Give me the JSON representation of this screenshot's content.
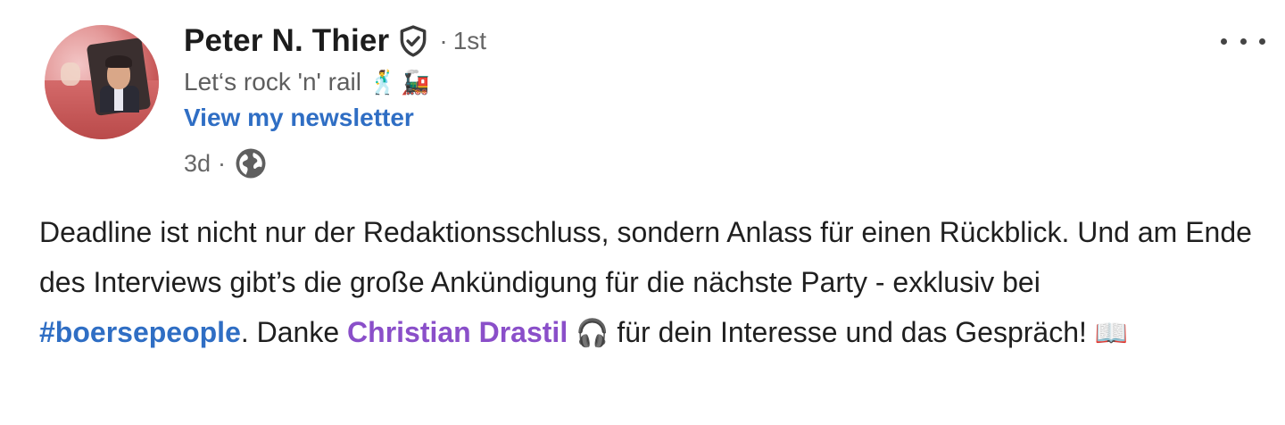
{
  "post": {
    "author": {
      "name": "Peter N. Thier",
      "degree_sep": "·",
      "degree": "1st",
      "tagline": "Let‘s rock 'n' rail",
      "tagline_emojis": [
        "🕺",
        "🚂"
      ],
      "newsletter_link": "View my newsletter"
    },
    "meta": {
      "time": "3d",
      "sep": "·"
    },
    "body": {
      "part1": "Deadline ist nicht nur der Redaktionsschluss, sondern Anlass für einen Rückblick. Und am Ende des Interviews gibt’s die große Ankündigung für die nächste Party - exklusiv bei ",
      "hashtag": "#boersepeople",
      "part2": ". Danke ",
      "mention": "Christian Drastil",
      "emoji_headphones": "🎧",
      "part3": " für dein Interesse und das Gespräch! ",
      "emoji_book": "📖"
    },
    "icons": {
      "verified": "verified-shield-icon",
      "globe": "globe-icon",
      "more": "more-options-icon"
    },
    "colors": {
      "link_blue": "#2f6ec4",
      "mention_purple": "#8a4fc9"
    }
  }
}
